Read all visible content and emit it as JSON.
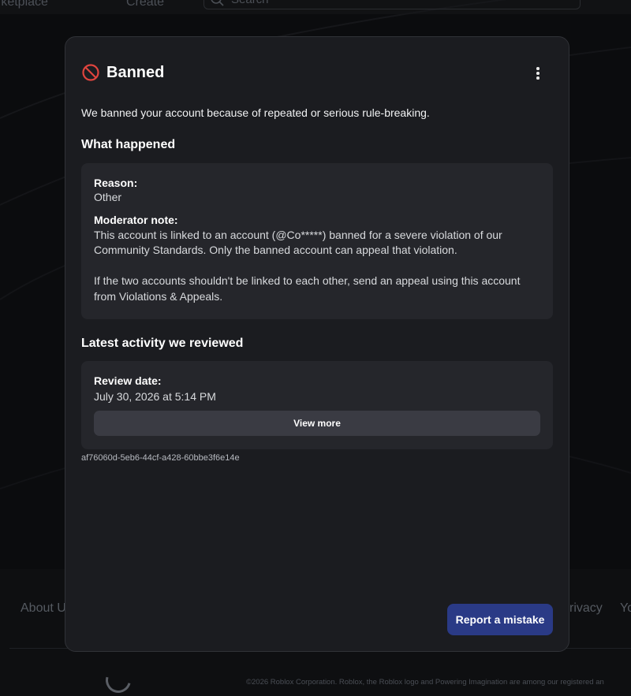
{
  "background": {
    "nav": [
      "rketplace",
      "Create"
    ],
    "search_placeholder": "Search",
    "footer_links": [
      "About U",
      "rivacy",
      "Yo"
    ],
    "copyright": "©2026 Roblox Corporation. Roblox, the Roblox logo and Powering Imagination are among our registered an"
  },
  "modal": {
    "icon": "ban-icon",
    "title": "Banned",
    "intro": "We banned your account because of repeated or serious rule-breaking.",
    "what_happened": {
      "heading": "What happened",
      "reason_label": "Reason:",
      "reason_value": "Other",
      "note_label": "Moderator note:",
      "note_line1": "This account is linked to an account (@Co*****) banned for a severe violation of our",
      "note_line2": "Community Standards. Only the banned account can appeal that violation.",
      "note_line3": "If the two accounts shouldn't be linked to each other, send an appeal using this account",
      "note_line4": "from Violations & Appeals."
    },
    "latest_activity": {
      "heading": "Latest activity we reviewed",
      "review_label": "Review date:",
      "review_value": "July 30, 2026 at 5:14 PM",
      "view_more": "View more"
    },
    "reference_id": "af76060d-5eb6-44cf-a428-60bbe3f6e14e",
    "report_button": "Report a mistake"
  },
  "colors": {
    "modal_bg": "#1b1c20",
    "card_bg": "#25262b",
    "primary_button": "#2a3a86",
    "ban_icon": "#e0443e"
  }
}
